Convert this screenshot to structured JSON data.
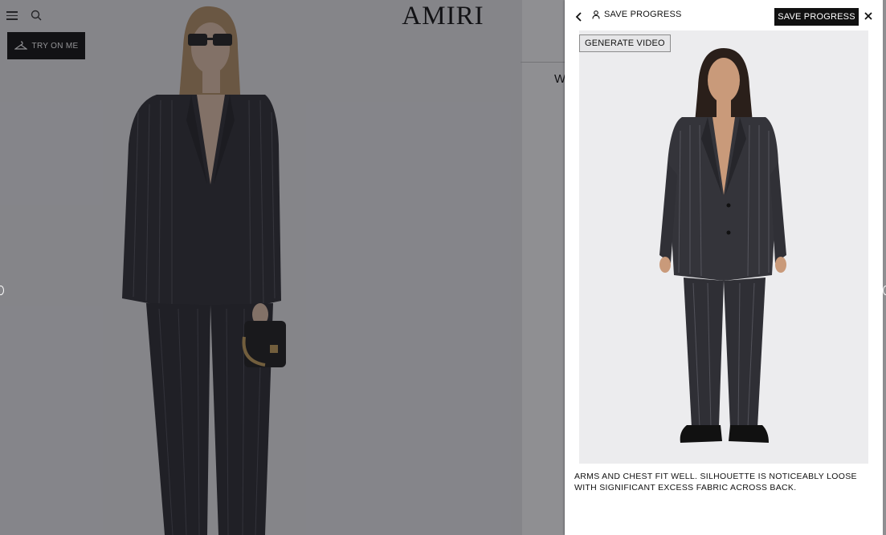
{
  "site": {
    "logo": "AMIRI",
    "try_on_label": "TRY ON ME",
    "partial_text": "W"
  },
  "panel": {
    "save_link_label": "SAVE PROGRESS",
    "save_button_label": "SAVE PROGRESS",
    "generate_video_label": "GENERATE VIDEO",
    "fit_note": "ARMS AND CHEST FIT WELL. SILHOUETTE IS NOTICEABLY LOOSE WITH SIGNIFICANT EXCESS FABRIC ACROSS BACK."
  },
  "icons": {
    "menu": "hamburger-icon",
    "search": "search-icon",
    "hanger": "hanger-icon",
    "back": "chevron-left-icon",
    "user": "user-icon",
    "close": "close-icon"
  },
  "colors": {
    "suit": "#2f2f35",
    "overlay": "#7d7d80",
    "button": "#111111"
  }
}
